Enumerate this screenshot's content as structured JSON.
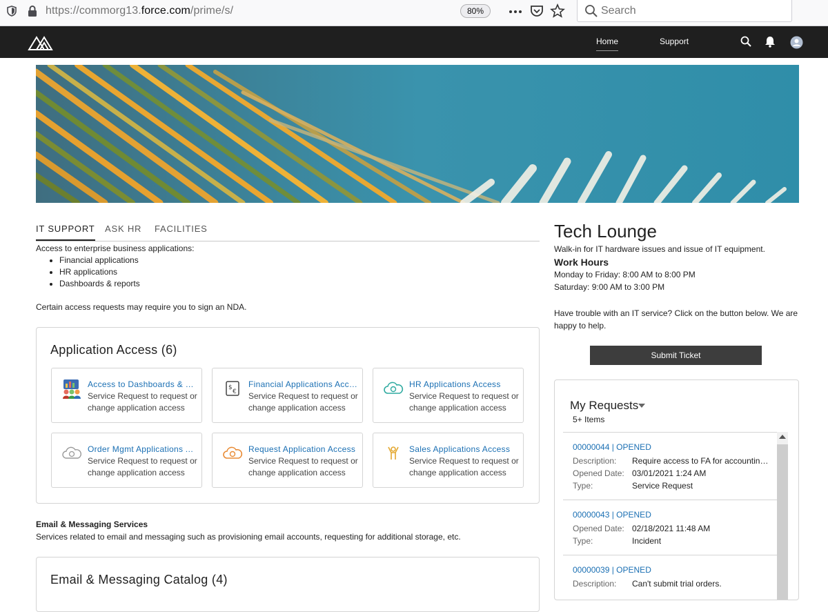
{
  "browser": {
    "url_prefix": "https://commorg13.",
    "url_domain": "force.com",
    "url_path": "/prime/s/",
    "zoom": "80%",
    "search_placeholder": "Search"
  },
  "header": {
    "nav": [
      "Home",
      "Support"
    ]
  },
  "tabs": [
    "IT SUPPORT",
    "ASK HR",
    "FACILITIES"
  ],
  "intro": {
    "lead": "Access to enterprise business applications:",
    "items": [
      "Financial applications",
      "HR applications",
      "Dashboards & reports"
    ],
    "note": "Certain access requests may require you to sign an NDA."
  },
  "catalog": {
    "title": "Application Access (6)",
    "tiles": [
      {
        "name": "Access to Dashboards & Reports",
        "desc": "Service Request to request or change application access",
        "icon": "dashboard-people-icon"
      },
      {
        "name": "Financial Applications Access",
        "desc": "Service Request to request or change application access",
        "icon": "currency-exchange-icon"
      },
      {
        "name": "HR Applications Access",
        "desc": "Service Request to request or change application access",
        "icon": "cloud-hr-icon"
      },
      {
        "name": "Order Mgmt Applications Access",
        "desc": "Service Request to request or change application access",
        "icon": "cloud-order-icon"
      },
      {
        "name": "Request Application Access",
        "desc": "Service Request to request or change application access",
        "icon": "cloud-request-icon"
      },
      {
        "name": "Sales Applications Access",
        "desc": "Service Request to request or change application access",
        "icon": "sales-person-icon"
      }
    ]
  },
  "email_section": {
    "heading": "Email & Messaging Services",
    "desc": "Services related to email and messaging such as provisioning email accounts, requesting for additional storage, etc.",
    "catalog_title": "Email & Messaging Catalog (4)"
  },
  "tech_lounge": {
    "title": "Tech Lounge",
    "subtitle": "Walk-in for IT hardware issues and issue of IT equipment.",
    "hours_heading": "Work Hours",
    "weekday": "Monday to Friday: 8:00 AM to 8:00 PM",
    "saturday": "Saturday: 9:00 AM to 3:00 PM",
    "help_line1": "Have trouble with an IT service? Click on the button below. We are",
    "help_line2": "happy to help.",
    "submit_label": "Submit Ticket"
  },
  "my_requests": {
    "title": "My Requests",
    "count": "5+ Items",
    "labels": {
      "description": "Description:",
      "opened": "Opened Date:",
      "type": "Type:"
    },
    "items": [
      {
        "id": "00000044 | OPENED",
        "description": "Require access to FA for accounting l...",
        "opened": "03/01/2021 1:24 AM",
        "type": "Service Request"
      },
      {
        "id": "00000043 | OPENED",
        "opened": "02/18/2021 11:48 AM",
        "type": "Incident"
      },
      {
        "id": "00000039 | OPENED",
        "description": "Can't submit trial orders."
      }
    ]
  }
}
